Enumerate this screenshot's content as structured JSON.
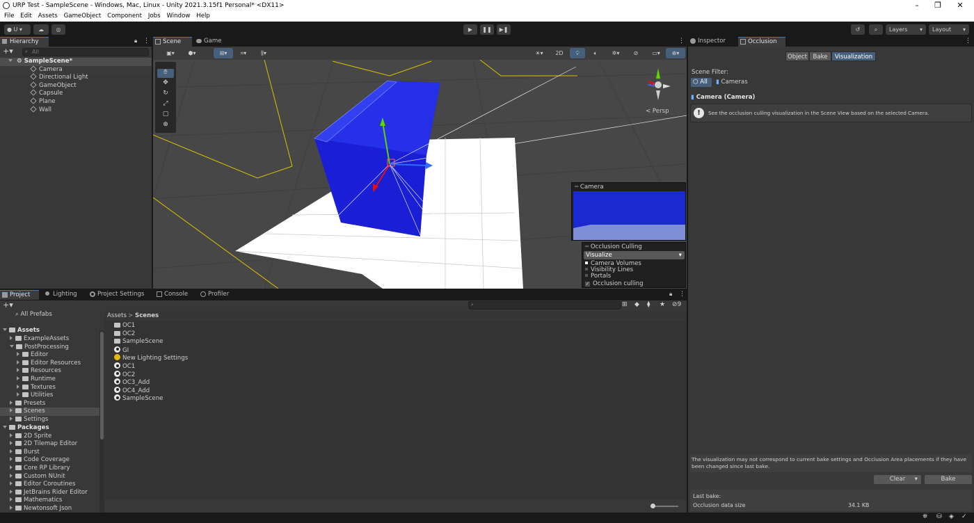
{
  "window": {
    "title": "URP Test - SampleScene - Windows, Mac, Linux - Unity 2021.3.15f1 Personal* <DX11>"
  },
  "menu": [
    "File",
    "Edit",
    "Assets",
    "GameObject",
    "Component",
    "Jobs",
    "Window",
    "Help"
  ],
  "toolbar": {
    "account": "U",
    "layers": "Layers",
    "layout": "Layout"
  },
  "hierarchy": {
    "tab": "Hierarchy",
    "search_placeholder": "All",
    "scene": "SampleScene*",
    "items": [
      "Camera",
      "Directional Light",
      "GameObject",
      "Capsule",
      "Plane",
      "Wall"
    ]
  },
  "scene_tabs": [
    "Scene",
    "Game"
  ],
  "scene_view": {
    "toggle_2d": "2D",
    "persp": "< Persp",
    "camera_overlay": "Camera",
    "occlusion_overlay": {
      "title": "Occlusion Culling",
      "mode": "Visualize",
      "items": [
        "Camera Volumes",
        "Visibility Lines",
        "Portals"
      ],
      "checkbox": "Occlusion culling"
    }
  },
  "bottom_tabs": [
    "Project",
    "Lighting",
    "Project Settings",
    "Console",
    "Profiler"
  ],
  "project": {
    "hidden_count": "9",
    "favorites": "All Prefabs",
    "assets_root": "Assets",
    "tree_assets": [
      {
        "label": "ExampleAssets",
        "depth": 1,
        "exp": false
      },
      {
        "label": "PostProcessing",
        "depth": 1,
        "exp": true
      },
      {
        "label": "Editor",
        "depth": 2,
        "exp": false
      },
      {
        "label": "Editor Resources",
        "depth": 2,
        "exp": false
      },
      {
        "label": "Resources",
        "depth": 2,
        "exp": false
      },
      {
        "label": "Runtime",
        "depth": 2,
        "exp": false
      },
      {
        "label": "Textures",
        "depth": 2,
        "exp": false
      },
      {
        "label": "Utilities",
        "depth": 2,
        "exp": false
      },
      {
        "label": "Presets",
        "depth": 1,
        "exp": false
      },
      {
        "label": "Scenes",
        "depth": 1,
        "exp": false,
        "selected": true
      },
      {
        "label": "Settings",
        "depth": 1,
        "exp": false
      }
    ],
    "packages_root": "Packages",
    "tree_packages": [
      "2D Sprite",
      "2D Tilemap Editor",
      "Burst",
      "Code Coverage",
      "Core RP Library",
      "Custom NUnit",
      "Editor Coroutines",
      "JetBrains Rider Editor",
      "Mathematics",
      "Newtonsoft Json"
    ],
    "breadcrumb": [
      "Assets",
      "Scenes"
    ],
    "files": [
      {
        "name": "OC1",
        "type": "folder"
      },
      {
        "name": "OC2",
        "type": "folder"
      },
      {
        "name": "SampleScene",
        "type": "folder"
      },
      {
        "name": "GI",
        "type": "scene"
      },
      {
        "name": "New Lighting Settings",
        "type": "lighting"
      },
      {
        "name": "OC1",
        "type": "scene"
      },
      {
        "name": "OC2",
        "type": "scene"
      },
      {
        "name": "OC3_Add",
        "type": "scene"
      },
      {
        "name": "OC4_Add",
        "type": "scene"
      },
      {
        "name": "SampleScene",
        "type": "scene"
      }
    ]
  },
  "occlusion": {
    "tabs": [
      "Inspector",
      "Occlusion"
    ],
    "modes": [
      "Object",
      "Bake",
      "Visualization"
    ],
    "scene_filter_label": "Scene Filter:",
    "filter_all": "All",
    "filter_cameras": "Cameras",
    "camera_title": "Camera (Camera)",
    "info": "See the occlusion culling visualization in the Scene View based on the selected Camera.",
    "warning": "The visualization may not correspond to current bake settings and Occlusion Area placements if they have been changed since last bake.",
    "clear": "Clear",
    "bake": "Bake",
    "last_bake_label": "Last bake:",
    "data_size_label": "Occlusion data size",
    "data_size_value": "34.1 KB"
  }
}
